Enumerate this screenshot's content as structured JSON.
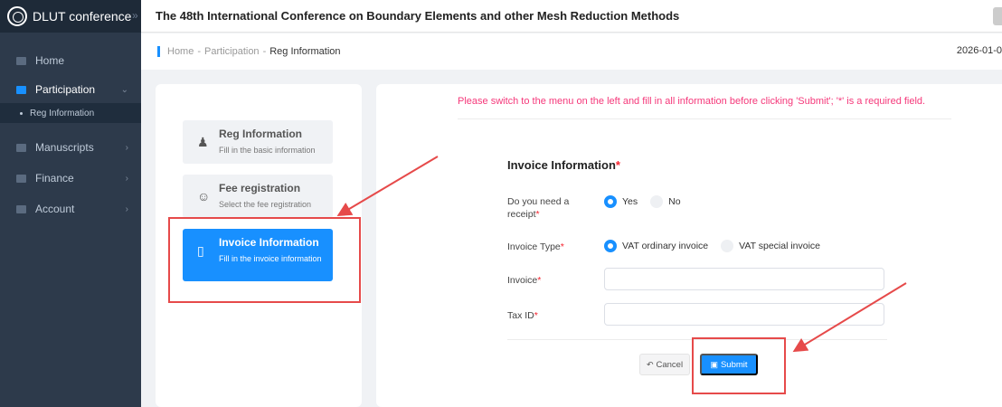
{
  "sidebar": {
    "brand": "DLUT conference",
    "collapse_glyph": "»",
    "items": [
      {
        "label": "Home",
        "icon": "home-icon"
      },
      {
        "label": "Participation",
        "icon": "participation-icon",
        "arrow": "⌄"
      },
      {
        "label": "Manuscripts",
        "icon": "folder-icon",
        "arrow": "›"
      },
      {
        "label": "Finance",
        "icon": "card-icon",
        "arrow": "›"
      },
      {
        "label": "Account",
        "icon": "user-icon",
        "arrow": "›"
      }
    ],
    "sub_item": "Reg Information"
  },
  "header": {
    "title": "The 48th International Conference on Boundary Elements and other Mesh Reduction Methods"
  },
  "breadcrumb": {
    "home": "Home",
    "sep": "-",
    "participation": "Participation",
    "current": "Reg Information",
    "date": "2026-01-0"
  },
  "steps": [
    {
      "title": "Reg Information",
      "desc": "Fill in the basic information",
      "icon": "user-edit-icon"
    },
    {
      "title": "Fee registration",
      "desc": "Select the fee registration",
      "icon": "mask-icon"
    },
    {
      "title": "Invoice Information",
      "desc": "Fill in the invoice information",
      "icon": "document-icon"
    }
  ],
  "form": {
    "notice": "Please switch to the menu on the left and fill in all information before clicking 'Submit'; '*' is a required field.",
    "section_title": "Invoice Information",
    "required_mark": "*",
    "receipt_label": "Do you need a receipt",
    "receipt_options": {
      "yes": "Yes",
      "no": "No",
      "selected": "Yes"
    },
    "type_label": "Invoice Type",
    "type_options": {
      "ordinary": "VAT ordinary invoice",
      "special": "VAT special invoice",
      "selected": "VAT ordinary invoice"
    },
    "invoice_label": "Invoice",
    "invoice_value": "",
    "taxid_label": "Tax ID",
    "taxid_value": "",
    "cancel_label": "Cancel",
    "submit_label": "Submit"
  },
  "colors": {
    "sidebar": "#2d3a4b",
    "accent": "#1890ff",
    "notice": "#f5387a",
    "annotation": "#e64a4a"
  }
}
